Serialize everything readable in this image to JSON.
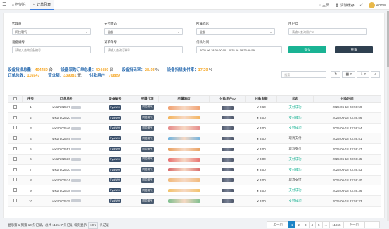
{
  "topbar": {
    "menu_icon": "menu-icon",
    "tabs": [
      {
        "label": "控制台",
        "icon": "home-icon"
      },
      {
        "label": "订单列表",
        "icon": "home-icon"
      }
    ],
    "right": {
      "home": "主页",
      "clear_cache": "清除缓存",
      "fullscreen_icon": "expand-icon",
      "user": "Admin"
    }
  },
  "filters": {
    "agent": {
      "label": "代理商",
      "value": "阿拉朝气"
    },
    "status": {
      "label": "支付状态",
      "value": "全部"
    },
    "hotel": {
      "label": "所属酒店",
      "value": "全部"
    },
    "user_id": {
      "label": "用户ID",
      "placeholder": "请输入查询用户ID"
    },
    "device_no": {
      "label": "设备编号",
      "placeholder": "请输入查询设备编号"
    },
    "order_no": {
      "label": "订单单号",
      "placeholder": "请输入查询订单号"
    },
    "pay_time": {
      "label": "付款时间",
      "value": "2025-06-18 00:00:00 - 2025-06-18 23:59:59"
    },
    "submit": "提交",
    "reset": "重置"
  },
  "stats": {
    "line1": [
      {
        "key": "设备扫描总量：",
        "value": "404480",
        "unit": "台"
      },
      {
        "key": "设备采购订单总量：",
        "value": "404480",
        "unit": "台"
      },
      {
        "key": "设备扫码率：",
        "value": "28.93",
        "unit": "%"
      },
      {
        "key": "设备扫描支付率：",
        "value": "17.29",
        "unit": "%"
      }
    ],
    "line2": [
      {
        "key": "订单总数：",
        "value": "116547",
        "unit": ""
      },
      {
        "key": "营业额：",
        "value": "339081",
        "unit": "元"
      },
      {
        "key": "付款用户：",
        "value": "70889",
        "unit": ""
      }
    ]
  },
  "toolbar": {
    "search_placeholder": "搜索",
    "buttons": [
      "refresh-icon",
      "grid-icon",
      "columns-icon",
      "export-icon",
      "search-icon"
    ]
  },
  "table": {
    "headers": [
      "",
      "序号",
      "订单单号",
      "设备编号",
      "所属代理",
      "所属酒店",
      "付款用户ID",
      "付款金额",
      "状态",
      "付款时间"
    ],
    "rows": [
      {
        "seq": "1",
        "order": "wx17502577",
        "device": "Typ8WH",
        "agent": "阿拉朝气",
        "hotel_color": "#f0a070",
        "amount": "¥ 0.60",
        "status": "支付成功",
        "time": "2025-06-18 23:59:59"
      },
      {
        "seq": "2",
        "order": "wx17502520",
        "device": "Typ8WH",
        "agent": "阿拉朝气",
        "hotel_color": "#f3b35c",
        "amount": "¥ 3.00",
        "status": "支付成功",
        "time": "2025-06-18 23:59:56"
      },
      {
        "seq": "3",
        "order": "wx17502546",
        "device": "Typ8WH",
        "agent": "阿拉朝气",
        "hotel_color": "#e58a8a",
        "amount": "¥ 3.00",
        "status": "支付成功",
        "time": "2025-06-18 23:59:54"
      },
      {
        "seq": "4",
        "order": "wx17502544",
        "device": "Typ8WH",
        "agent": "阿拉朝气",
        "hotel_color": "#6fb3e0",
        "amount": "¥ 3.00",
        "status": "取消支付",
        "time": "2025-06-18 23:59:51"
      },
      {
        "seq": "5",
        "order": "wx17502557",
        "device": "Typ8WH",
        "agent": "阿拉朝气",
        "hotel_color": "#e8a060",
        "amount": "¥ 3.00",
        "status": "取消支付",
        "time": "2025-06-18 23:59:47"
      },
      {
        "seq": "6",
        "order": "wx17502536",
        "device": "Typ8WH",
        "agent": "阿拉朝气",
        "hotel_color": "#e87070",
        "amount": "¥ 3.00",
        "status": "支付成功",
        "time": "2025-06-18 23:59:45"
      },
      {
        "seq": "7",
        "order": "wx17502530",
        "device": "Typ8WH",
        "agent": "阿拉朝气",
        "hotel_color": "#d86a6a",
        "amount": "¥ 3.00",
        "status": "支付成功",
        "time": "2025-06-18 23:59:43"
      },
      {
        "seq": "8",
        "order": "wx17502514",
        "device": "Typ8WH",
        "agent": "阿拉朝气",
        "hotel_color": "#f1b97a",
        "amount": "¥ 3.00",
        "status": "取消支付",
        "time": "2025-06-18 23:59:40"
      },
      {
        "seq": "9",
        "order": "wx17502518",
        "device": "Typ8WH",
        "agent": "阿拉朝气",
        "hotel_color": "#f3c26a",
        "amount": "¥ 3.00",
        "status": "支付成功",
        "time": "2025-06-18 23:59:36"
      },
      {
        "seq": "10",
        "order": "wx17502515",
        "device": "Typ8WH",
        "agent": "阿拉朝气",
        "hotel_color": "#7fbf8f",
        "amount": "¥ 3.00",
        "status": "支付成功",
        "time": "2025-06-18 23:59:33"
      }
    ]
  },
  "footer": {
    "text_before": "显示第 1 到第 10 条记录，总共 116547 条记录 每页显示",
    "page_size": "10",
    "text_after": "条记录"
  },
  "pager": {
    "prev": "上一页",
    "pages": [
      "1",
      "2",
      "3",
      "4",
      "5",
      "...",
      "11655"
    ],
    "next": "下一页"
  },
  "colors": {
    "accent": "#1ab394",
    "primary": "#1c84c6",
    "stat_value": "#f5a623",
    "stat_key": "#2b6cb0"
  }
}
